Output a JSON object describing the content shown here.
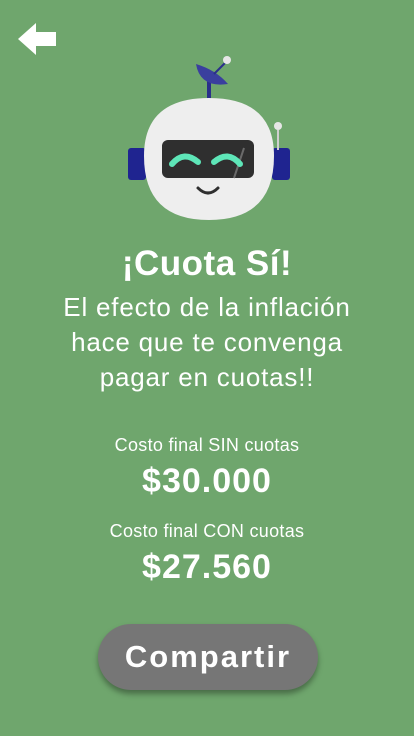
{
  "header": {
    "back_icon": "arrow-left-icon"
  },
  "mascot": {
    "icon": "robot-mascot-icon"
  },
  "main": {
    "title": "¡Cuota Sí!",
    "subtitle_lines": [
      "El efecto de la inflación",
      "hace que te convenga",
      "pagar en cuotas!!"
    ],
    "without_installments": {
      "label": "Costo final SIN cuotas",
      "amount": "$30.000"
    },
    "with_installments": {
      "label": "Costo final CON cuotas",
      "amount": "$27.560"
    }
  },
  "actions": {
    "share_label": "Compartir"
  },
  "colors": {
    "background": "#6fa66d",
    "button": "#767676",
    "text": "#ffffff"
  }
}
